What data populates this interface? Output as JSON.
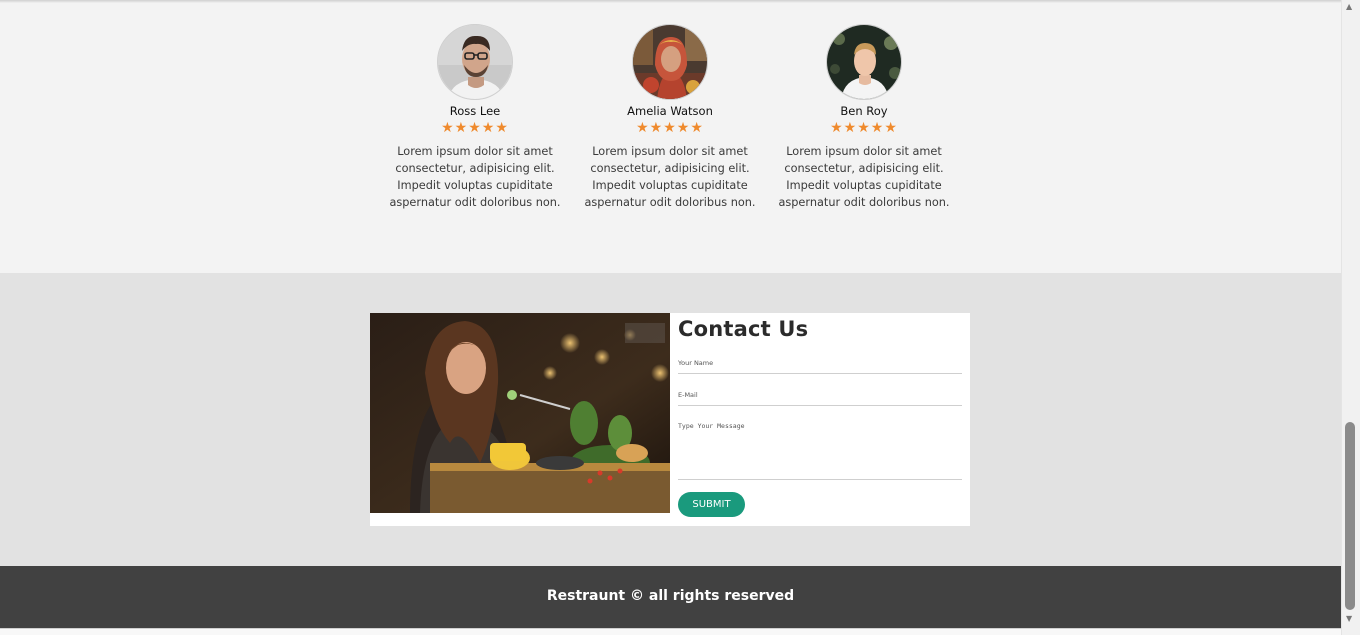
{
  "testimonials": [
    {
      "name": "Ross Lee",
      "rating": 5,
      "stars": "★★★★★",
      "text": "Lorem ipsum dolor sit amet consectetur, adipisicing elit. Impedit voluptas cupiditate aspernatur odit doloribus non.",
      "avatar": "man-with-glasses-avatar"
    },
    {
      "name": "Amelia Watson",
      "rating": 5,
      "stars": "★★★★★",
      "text": "Lorem ipsum dolor sit amet consectetur, adipisicing elit. Impedit voluptas cupiditate aspernatur odit doloribus non.",
      "avatar": "woman-with-headscarf-avatar"
    },
    {
      "name": "Ben Roy",
      "rating": 5,
      "stars": "★★★★★",
      "text": "Lorem ipsum dolor sit amet consectetur, adipisicing elit. Impedit voluptas cupiditate aspernatur odit doloribus non.",
      "avatar": "man-in-white-shirt-avatar"
    }
  ],
  "contact": {
    "title": "Contact Us",
    "name_placeholder": "Your Name",
    "email_placeholder": "E-Mail",
    "message_placeholder": "Type Your Message",
    "submit_label": "SUBMIT",
    "photo": "woman-dining-photo"
  },
  "footer": {
    "text": "Restraunt © all rights reserved"
  },
  "scrollbar": {
    "up_icon": "▲",
    "down_icon": "▼"
  },
  "colors": {
    "star": "#ef8a2d",
    "submit": "#1a9a7d",
    "footer": "#414141",
    "contact_bg": "#e2e2e2",
    "testimonials_bg": "#f3f3f3"
  }
}
